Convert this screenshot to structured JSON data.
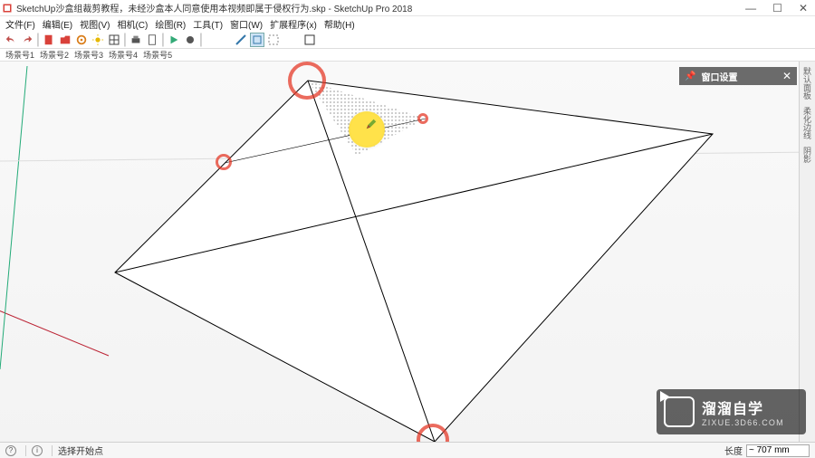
{
  "window": {
    "title": "SketchUp沙盒组裁剪教程，未经沙盒本人同意使用本视频即属于侵权行为.skp - SketchUp Pro 2018",
    "min_label": "—",
    "max_label": "☐",
    "close_label": "✕"
  },
  "menu": {
    "file": "文件(F)",
    "edit": "编辑(E)",
    "view": "视图(V)",
    "camera": "相机(C)",
    "draw": "绘图(R)",
    "tools": "工具(T)",
    "window": "窗口(W)",
    "extensions": "扩展程序(x)",
    "help": "帮助(H)"
  },
  "toolbar": {
    "undo": "↶",
    "redo": "↷",
    "new": "□",
    "open": "📂",
    "gear": "⚙",
    "light": "✺",
    "doc": "▥",
    "shadow": "▤",
    "print1": "⎙",
    "print2": "⎙",
    "play": "▷",
    "dot": "•",
    "divider": "|",
    "edge1": "╱",
    "edge2": "▭",
    "edge3": "▦",
    "tool1": "⬚"
  },
  "scenes": {
    "items": [
      "场景号1",
      "场景号2",
      "场景号3",
      "场景号4",
      "场景号5"
    ]
  },
  "tray": {
    "title": "窗口设置",
    "pin_icon": "📌",
    "close_icon": "✕"
  },
  "right_rail": {
    "items": [
      "默认面板",
      "柔化边线",
      "阴影"
    ]
  },
  "status": {
    "hint": "选择开始点",
    "vcb_label": "长度",
    "vcb_value": "~ 707 mm"
  },
  "watermark": {
    "brand": "溜溜自学",
    "url": "ZIXUE.3D66.COM"
  },
  "chart_data": {
    "type": "scene",
    "description": "Perspective view of a white square surface with two construction diagonals forming a pyramid apex. Ground plane visible with green and red axes. Pencil tool active near apex.",
    "axes": {
      "red": true,
      "green": true,
      "blue_hidden": true
    },
    "active_tool": "Line (pencil)",
    "inference_highlight": "endpoint/midpoint snapping shown by red rings",
    "click_highlight_color": "#ffe24a"
  }
}
